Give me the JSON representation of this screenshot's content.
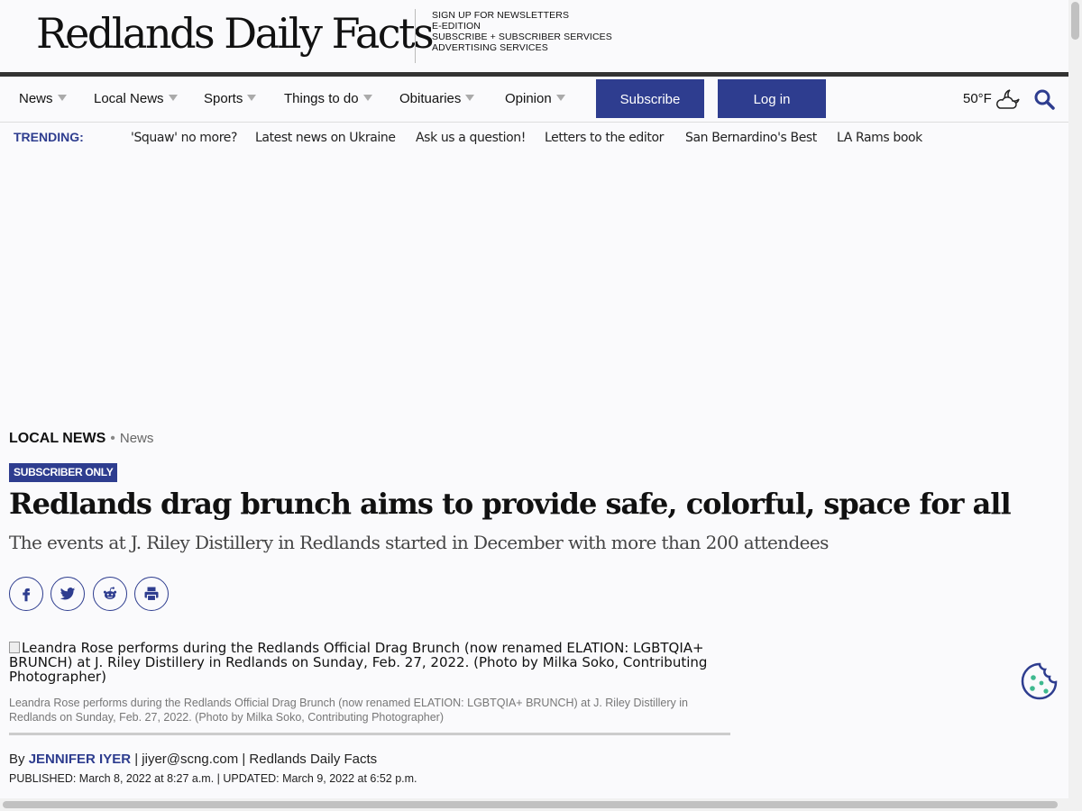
{
  "header": {
    "logo": "Redlands Daily Facts",
    "links": [
      "SIGN UP FOR NEWSLETTERS",
      "E-EDITION",
      "SUBSCRIBE + SUBSCRIBER SERVICES",
      "ADVERTISING SERVICES"
    ]
  },
  "nav": {
    "items": [
      "News",
      "Local News",
      "Sports",
      "Things to do",
      "Obituaries",
      "Opinion"
    ],
    "subscribe": "Subscribe",
    "login": "Log in",
    "weather": "50°F"
  },
  "trending": {
    "label": "TRENDING:",
    "links": [
      "'Squaw' no more?",
      "Latest news on Ukraine",
      "Ask us a question!",
      "Letters to the editor",
      "San Bernardino's Best",
      "LA Rams book"
    ]
  },
  "article": {
    "section": "LOCAL NEWS",
    "section_sep": "•",
    "subsection": "News",
    "badge": "SUBSCRIBER ONLY",
    "headline": "Redlands drag brunch aims to provide safe, colorful, space for all",
    "subhead": "The events at J. Riley Distillery in Redlands started in December with more than 200 attendees",
    "image_alt": "Leandra Rose performs during the Redlands Official Drag Brunch (now renamed ELATION: LGBTQIA+ BRUNCH) at J. Riley Distillery in Redlands on Sunday, Feb. 27, 2022. (Photo by Milka Soko, Contributing Photographer)",
    "caption": "Leandra Rose performs during the Redlands Official Drag Brunch (now renamed ELATION: LGBTQIA+ BRUNCH) at J. Riley Distillery in Redlands on Sunday, Feb. 27, 2022. (Photo by Milka Soko, Contributing Photographer)",
    "byline_prefix": "By",
    "author": "JENNIFER IYER",
    "byline_rest": "| jiyer@scng.com | Redlands Daily Facts",
    "dates": "PUBLISHED: March 8, 2022 at 8:27 a.m. | UPDATED: March 9, 2022 at 6:52 p.m."
  },
  "share_icons": [
    "facebook-icon",
    "twitter-icon",
    "reddit-icon",
    "print-icon"
  ],
  "colors": {
    "accent": "#2e3d8f",
    "cookie_dots": "#3fb98f"
  }
}
